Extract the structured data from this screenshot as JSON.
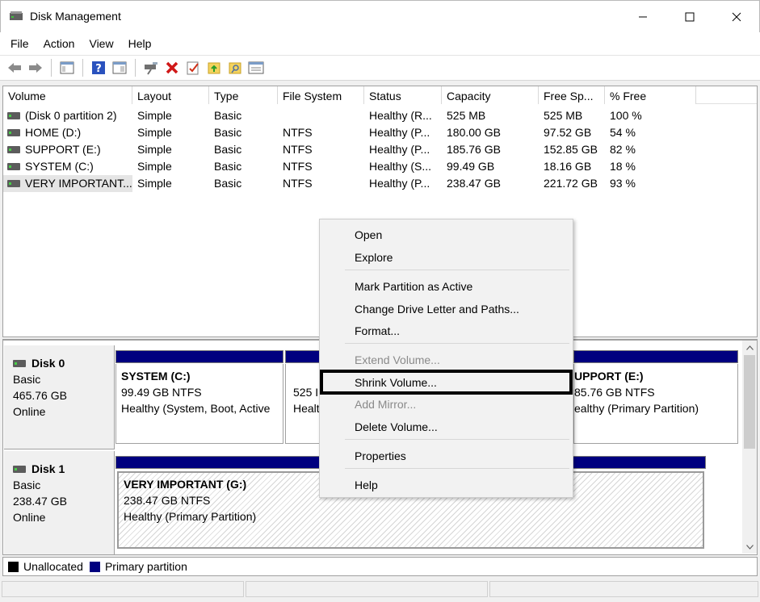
{
  "window": {
    "title": "Disk Management",
    "minimize_glyph": "—",
    "maximize_glyph": "☐",
    "close_glyph": "✕"
  },
  "menu": [
    "File",
    "Action",
    "View",
    "Help"
  ],
  "toolbar": {
    "icons": [
      "back-icon",
      "forward-icon",
      "console-tree-icon",
      "help-icon",
      "properties-icon",
      "connect-disk-icon",
      "delete-icon",
      "check-icon",
      "folder-up-icon",
      "folder-search-icon",
      "list-icon"
    ]
  },
  "volume_table": {
    "columns": [
      "Volume",
      "Layout",
      "Type",
      "File System",
      "Status",
      "Capacity",
      "Free Sp...",
      "% Free"
    ],
    "rows": [
      {
        "volume": "(Disk 0 partition 2)",
        "layout": "Simple",
        "type": "Basic",
        "fs": "",
        "status": "Healthy (R...",
        "capacity": "525 MB",
        "free": "525 MB",
        "pct": "100 %"
      },
      {
        "volume": "HOME (D:)",
        "layout": "Simple",
        "type": "Basic",
        "fs": "NTFS",
        "status": "Healthy (P...",
        "capacity": "180.00 GB",
        "free": "97.52 GB",
        "pct": "54 %"
      },
      {
        "volume": "SUPPORT (E:)",
        "layout": "Simple",
        "type": "Basic",
        "fs": "NTFS",
        "status": "Healthy (P...",
        "capacity": "185.76 GB",
        "free": "152.85 GB",
        "pct": "82 %"
      },
      {
        "volume": "SYSTEM (C:)",
        "layout": "Simple",
        "type": "Basic",
        "fs": "NTFS",
        "status": "Healthy (S...",
        "capacity": "99.49 GB",
        "free": "18.16 GB",
        "pct": "18 %"
      },
      {
        "volume": "VERY IMPORTANT...",
        "layout": "Simple",
        "type": "Basic",
        "fs": "NTFS",
        "status": "Healthy (P...",
        "capacity": "238.47 GB",
        "free": "221.72 GB",
        "pct": "93 %"
      }
    ]
  },
  "disks": [
    {
      "name": "Disk 0",
      "type": "Basic",
      "size": "465.76 GB",
      "state": "Online",
      "partitions": [
        {
          "title": "SYSTEM  (C:)",
          "line1": "99.49 GB NTFS",
          "line2": "Healthy (System, Boot, Active"
        },
        {
          "title": "",
          "line1": "525 I",
          "line2": "Healt"
        },
        {
          "title": "UPPORT  (E:)",
          "line1": "85.76 GB NTFS",
          "line2": "ealthy (Primary Partition)"
        }
      ]
    },
    {
      "name": "Disk 1",
      "type": "Basic",
      "size": "238.47 GB",
      "state": "Online",
      "partitions": [
        {
          "title": "VERY IMPORTANT  (G:)",
          "line1": "238.47 GB NTFS",
          "line2": "Healthy (Primary Partition)"
        }
      ]
    }
  ],
  "legend": [
    {
      "label": "Unallocated",
      "color": "#000000"
    },
    {
      "label": "Primary partition",
      "color": "#00007f"
    }
  ],
  "context_menu": {
    "items": [
      {
        "label": "Open",
        "enabled": true
      },
      {
        "label": "Explore",
        "enabled": true
      },
      {
        "label": "Mark Partition as Active",
        "enabled": true
      },
      {
        "label": "Change Drive Letter and Paths...",
        "enabled": true
      },
      {
        "label": "Format...",
        "enabled": true
      },
      {
        "label": "Extend Volume...",
        "enabled": false
      },
      {
        "label": "Shrink Volume...",
        "enabled": true,
        "highlighted": true
      },
      {
        "label": "Add Mirror...",
        "enabled": false
      },
      {
        "label": "Delete Volume...",
        "enabled": true
      },
      {
        "label": "Properties",
        "enabled": true
      },
      {
        "label": "Help",
        "enabled": true
      }
    ]
  },
  "colors": {
    "primary_partition": "#00007f",
    "highlight_border": "#000000"
  }
}
